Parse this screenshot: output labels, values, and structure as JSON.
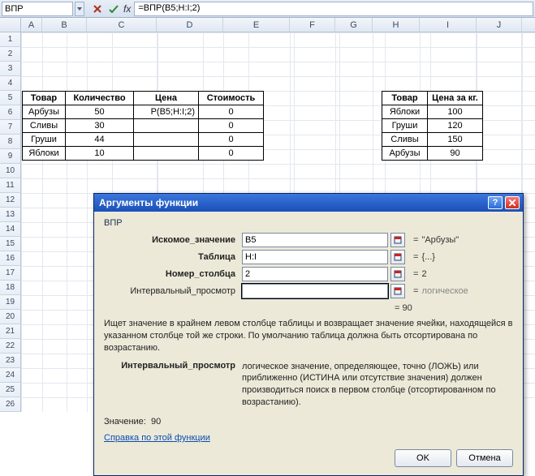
{
  "formula_bar": {
    "name_box": "ВПР",
    "formula": "=ВПР(B5;H:I;2)"
  },
  "columns": [
    "A",
    "B",
    "C",
    "D",
    "E",
    "F",
    "G",
    "H",
    "I",
    "J"
  ],
  "table_goods": {
    "headers": [
      "Товар",
      "Количество",
      "Цена",
      "Стоимость"
    ],
    "rows": [
      [
        "Арбузы",
        "50",
        "Р(B5;H:I;2)",
        "0"
      ],
      [
        "Сливы",
        "30",
        "",
        "0"
      ],
      [
        "Груши",
        "44",
        "",
        "0"
      ],
      [
        "Яблоки",
        "10",
        "",
        "0"
      ]
    ]
  },
  "table_prices": {
    "headers": [
      "Товар",
      "Цена за кг."
    ],
    "rows": [
      [
        "Яблоки",
        "100"
      ],
      [
        "Груши",
        "120"
      ],
      [
        "Сливы",
        "150"
      ],
      [
        "Арбузы",
        "90"
      ]
    ]
  },
  "dialog": {
    "title": "Аргументы функции",
    "function_name": "ВПР",
    "args": [
      {
        "label": "Искомое_значение",
        "bold": true,
        "value": "B5",
        "eval": "\"Арбузы\""
      },
      {
        "label": "Таблица",
        "bold": true,
        "value": "H:I",
        "eval": "{...}"
      },
      {
        "label": "Номер_столбца",
        "bold": true,
        "value": "2",
        "eval": "2"
      },
      {
        "label": "Интервальный_просмотр",
        "bold": false,
        "value": "",
        "eval": "логическое",
        "gray": true
      }
    ],
    "result_preview": "= 90",
    "description": "Ищет значение в крайнем левом столбце таблицы и возвращает значение ячейки, находящейся в указанном столбце той же строки. По умолчанию таблица должна быть отсортирована по возрастанию.",
    "arg_detail_label": "Интервальный_просмотр",
    "arg_detail_text": "логическое значение, определяющее, точно (ЛОЖЬ) или приближенно (ИСТИНА или отсутствие значения) должен производиться поиск в первом столбце (отсортированном по возрастанию).",
    "value_label": "Значение:",
    "value": "90",
    "help_link": "Справка по этой функции",
    "ok": "OK",
    "cancel": "Отмена"
  },
  "chart_data": {
    "type": "table",
    "tables": [
      {
        "title": "Goods",
        "columns": [
          "Товар",
          "Количество",
          "Цена",
          "Стоимость"
        ],
        "rows": [
          [
            "Арбузы",
            50,
            null,
            0
          ],
          [
            "Сливы",
            30,
            null,
            0
          ],
          [
            "Груши",
            44,
            null,
            0
          ],
          [
            "Яблоки",
            10,
            null,
            0
          ]
        ]
      },
      {
        "title": "Prices",
        "columns": [
          "Товар",
          "Цена за кг."
        ],
        "rows": [
          [
            "Яблоки",
            100
          ],
          [
            "Груши",
            120
          ],
          [
            "Сливы",
            150
          ],
          [
            "Арбузы",
            90
          ]
        ]
      }
    ]
  }
}
